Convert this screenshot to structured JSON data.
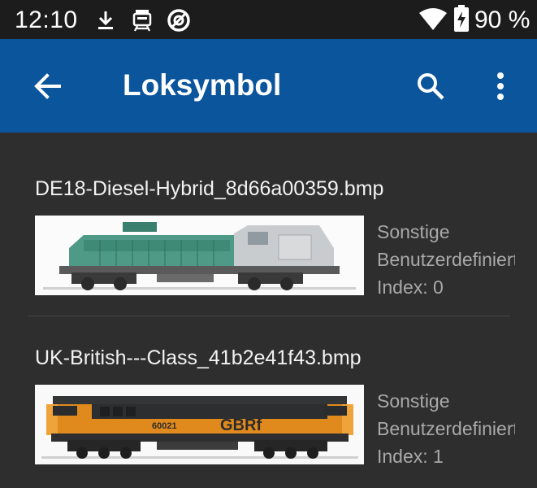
{
  "status": {
    "time": "12:10",
    "battery": "90 %",
    "icons": [
      "download-icon",
      "train-notification-icon",
      "no-disturb-icon",
      "wifi-icon",
      "battery-charging-icon"
    ]
  },
  "appbar": {
    "title": "Loksymbol",
    "icons": [
      "back-arrow-icon",
      "search-icon",
      "more-vert-icon"
    ]
  },
  "items": [
    {
      "name": "DE18-Diesel-Hybrid_8d66a00359.bmp",
      "category": "Sonstige",
      "type": "Benutzerdefiniert",
      "index": "Index: 0",
      "image": "locomotive-de18-green-grey"
    },
    {
      "name": "UK-British---Class_41b2e41f43.bmp",
      "category": "Sonstige",
      "type": "Benutzerdefiniert",
      "index": "Index: 1",
      "image": "locomotive-class60-gbrf-orange",
      "livery_number": "60021",
      "livery_brand": "GBRf"
    }
  ],
  "colors": {
    "appbar": "#0b559d",
    "statusbar": "#1c1c1c",
    "background": "#2e2e2e"
  }
}
